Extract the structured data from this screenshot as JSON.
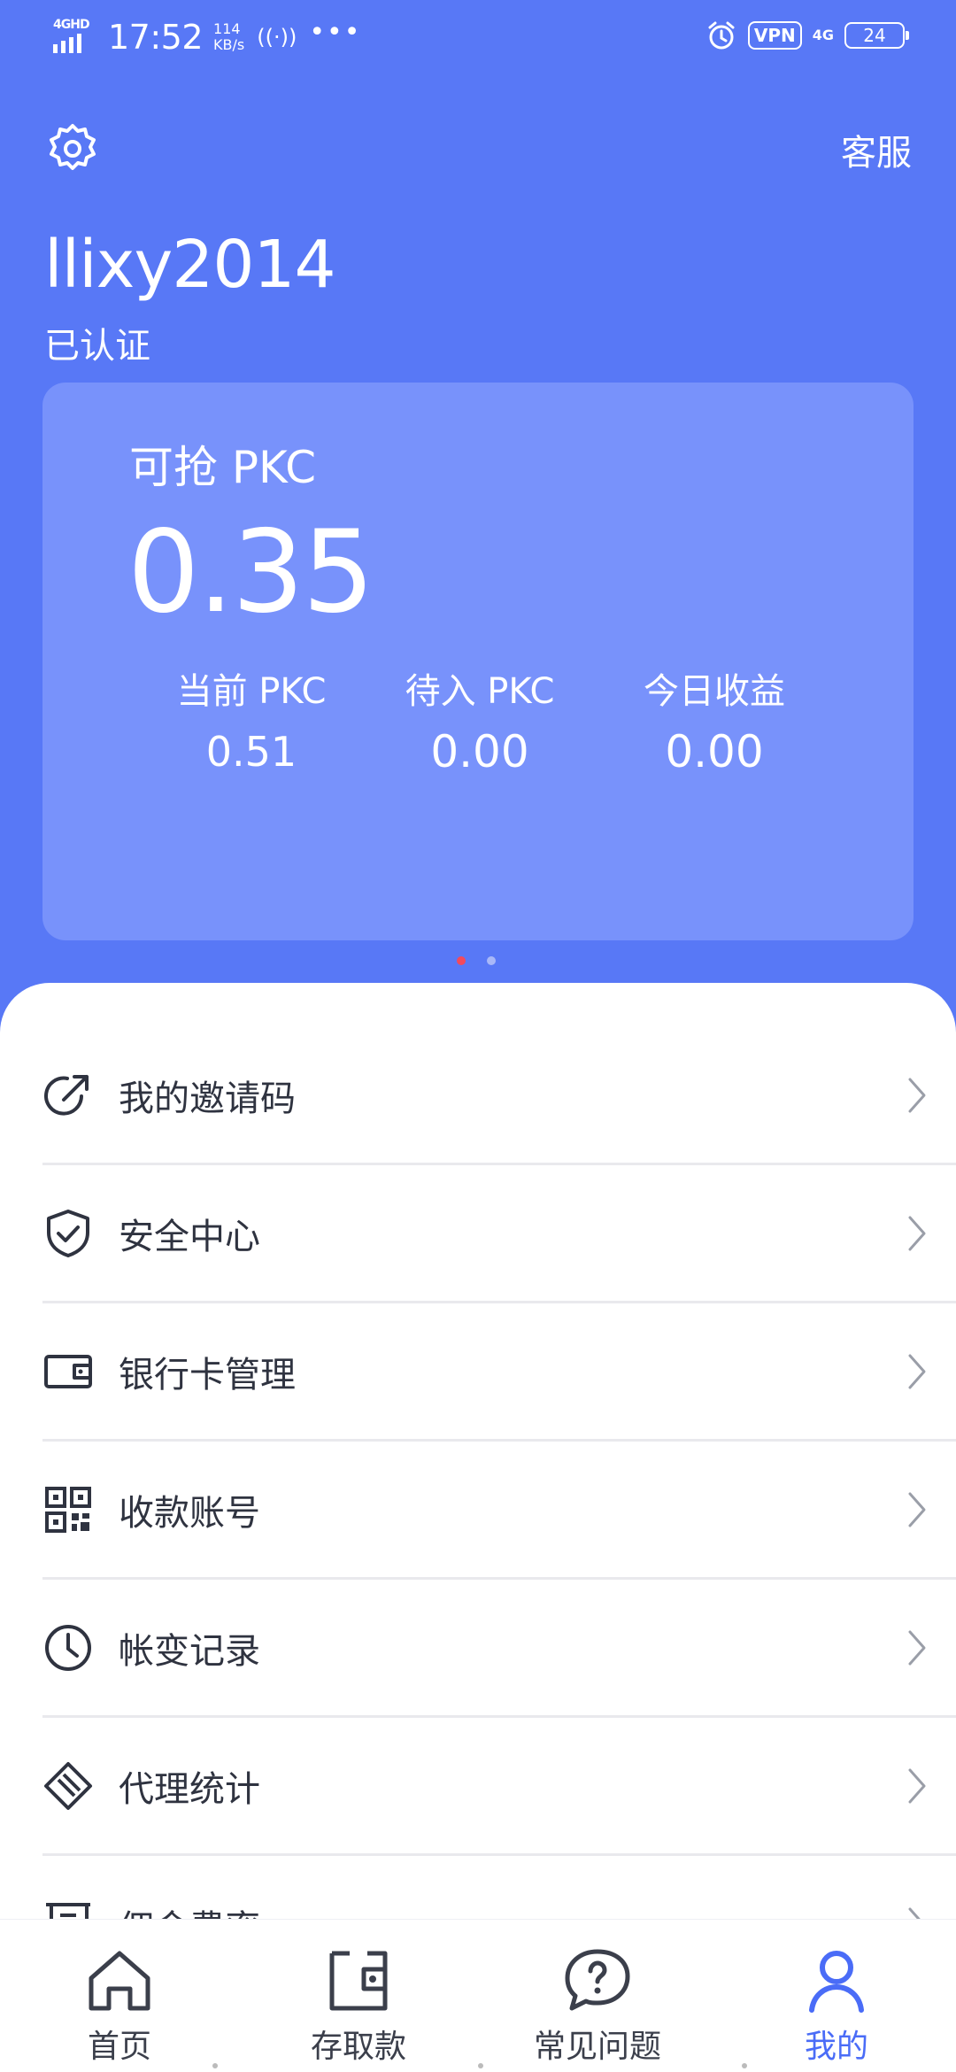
{
  "status_bar": {
    "network_label": "4GHD",
    "time": "17:52",
    "speed_value": "114",
    "speed_unit": "KB/s",
    "hotspot": "((·))",
    "more": "•••",
    "vpn": "VPN",
    "net_type": "4G",
    "battery": "24"
  },
  "header": {
    "service_label": "客服",
    "username": "llixy2014",
    "verified_label": "已认证"
  },
  "card": {
    "label": "可抢 PKC",
    "value": "0.35",
    "stats": [
      {
        "label": "当前 PKC",
        "value": "0.51"
      },
      {
        "label": "待入 PKC",
        "value": "0.00"
      },
      {
        "label": "今日收益",
        "value": "0.00"
      }
    ],
    "pager_active_index": 0,
    "pager_count": 2
  },
  "menu": {
    "items": [
      {
        "label": "我的邀请码",
        "icon": "share-icon"
      },
      {
        "label": "安全中心",
        "icon": "shield-check-icon"
      },
      {
        "label": "银行卡管理",
        "icon": "wallet-card-icon"
      },
      {
        "label": "收款账号",
        "icon": "qr-code-icon"
      },
      {
        "label": "帐变记录",
        "icon": "clock-icon"
      },
      {
        "label": "代理统计",
        "icon": "tag-icon"
      },
      {
        "label": "佣金费率",
        "icon": "receipt-icon"
      }
    ]
  },
  "tabbar": {
    "tabs": [
      {
        "label": "首页",
        "icon": "home-icon"
      },
      {
        "label": "存取款",
        "icon": "wallet-icon"
      },
      {
        "label": "常见问题",
        "icon": "question-bubble-icon"
      },
      {
        "label": "我的",
        "icon": "user-icon"
      }
    ],
    "active_index": 3
  },
  "colors": {
    "primary": "#5878f6",
    "card": "#7892fb",
    "active_tab": "#4a6cf7",
    "pager_active": "#f24a5c",
    "icon": "#2f3340"
  }
}
